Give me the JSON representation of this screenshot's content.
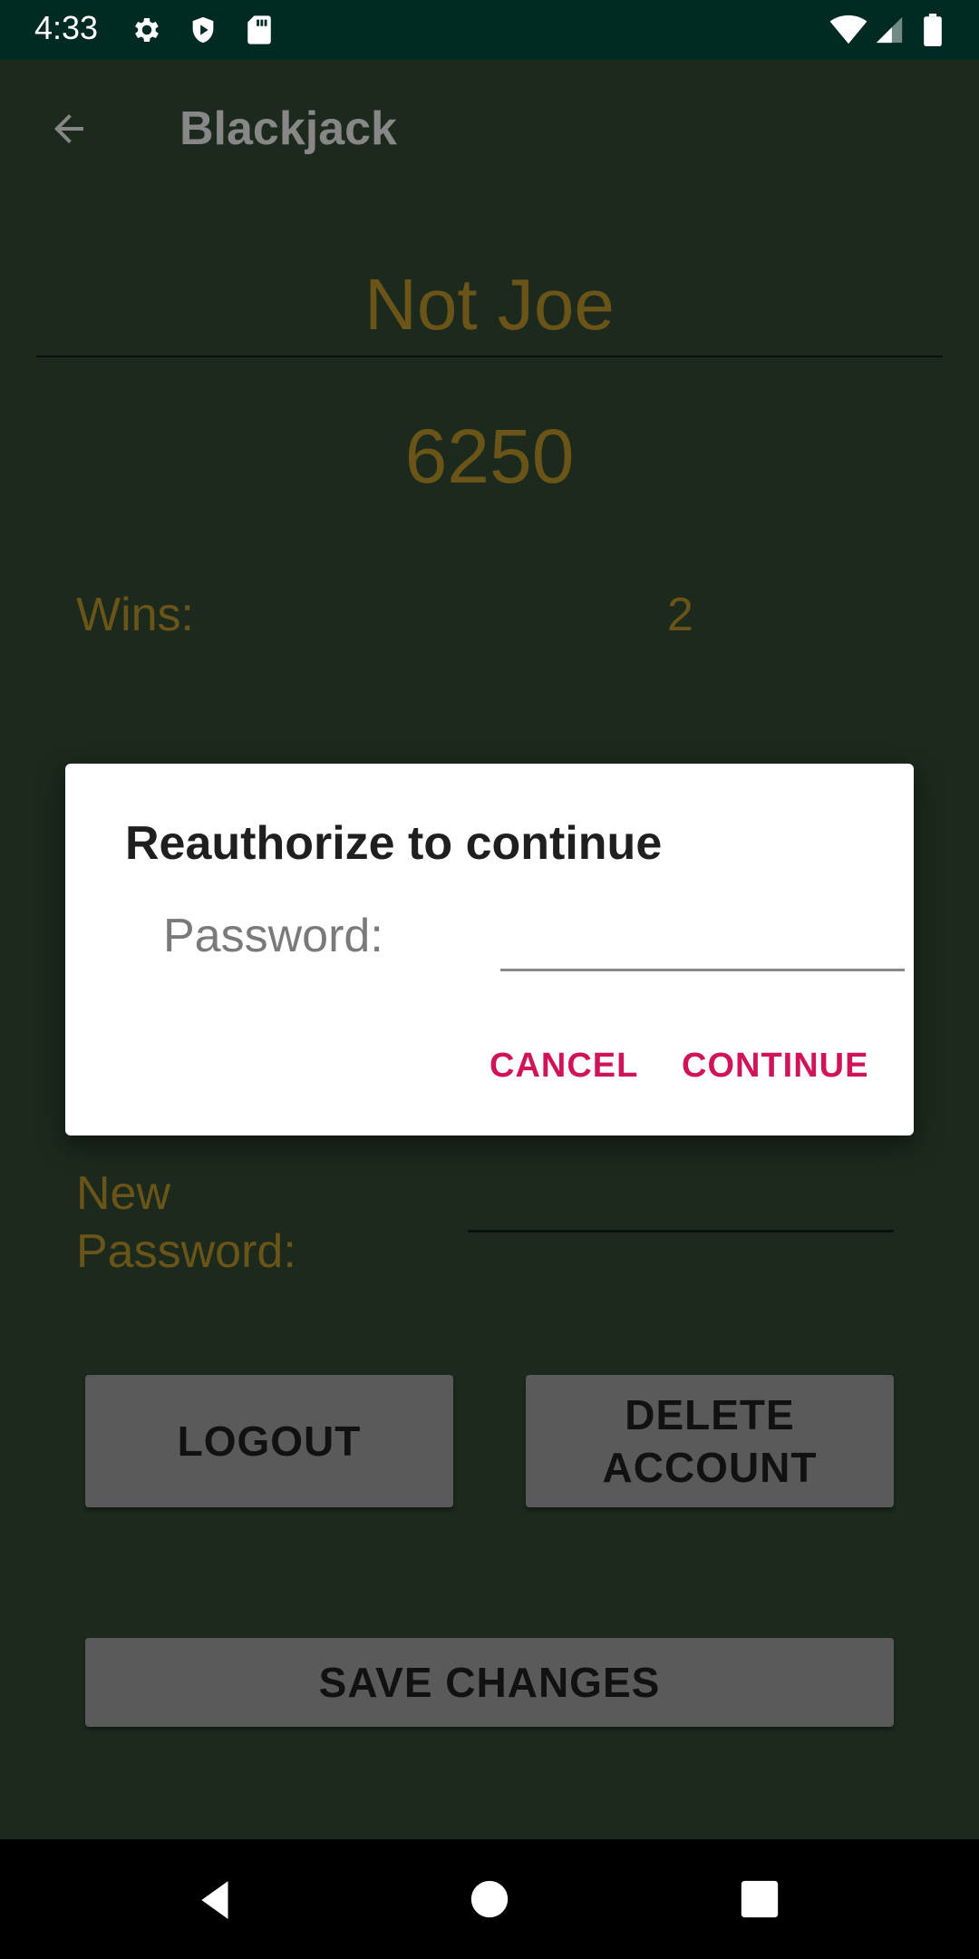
{
  "status_bar": {
    "time": "4:33",
    "icons_left": [
      "gear-icon",
      "shield-icon",
      "sd-card-icon"
    ],
    "icons_right": [
      "wifi-icon",
      "signal-icon",
      "battery-icon"
    ]
  },
  "app_bar": {
    "title": "Blackjack",
    "back_icon": "arrow-left-icon"
  },
  "profile": {
    "username": "Not Joe",
    "score": "6250",
    "wins_label": "Wins:",
    "wins_value": "2",
    "new_password_label": "New\nPassword:"
  },
  "buttons": {
    "logout": "LOGOUT",
    "delete_account": "DELETE\nACCOUNT",
    "save_changes": "SAVE CHANGES"
  },
  "dialog": {
    "title": "Reauthorize to continue",
    "password_label": "Password:",
    "password_value": "",
    "cancel": "CANCEL",
    "continue": "CONTINUE"
  },
  "colors": {
    "accent": "#d0145a",
    "background": "#1b2a1d",
    "gold_text": "#6b5418"
  }
}
